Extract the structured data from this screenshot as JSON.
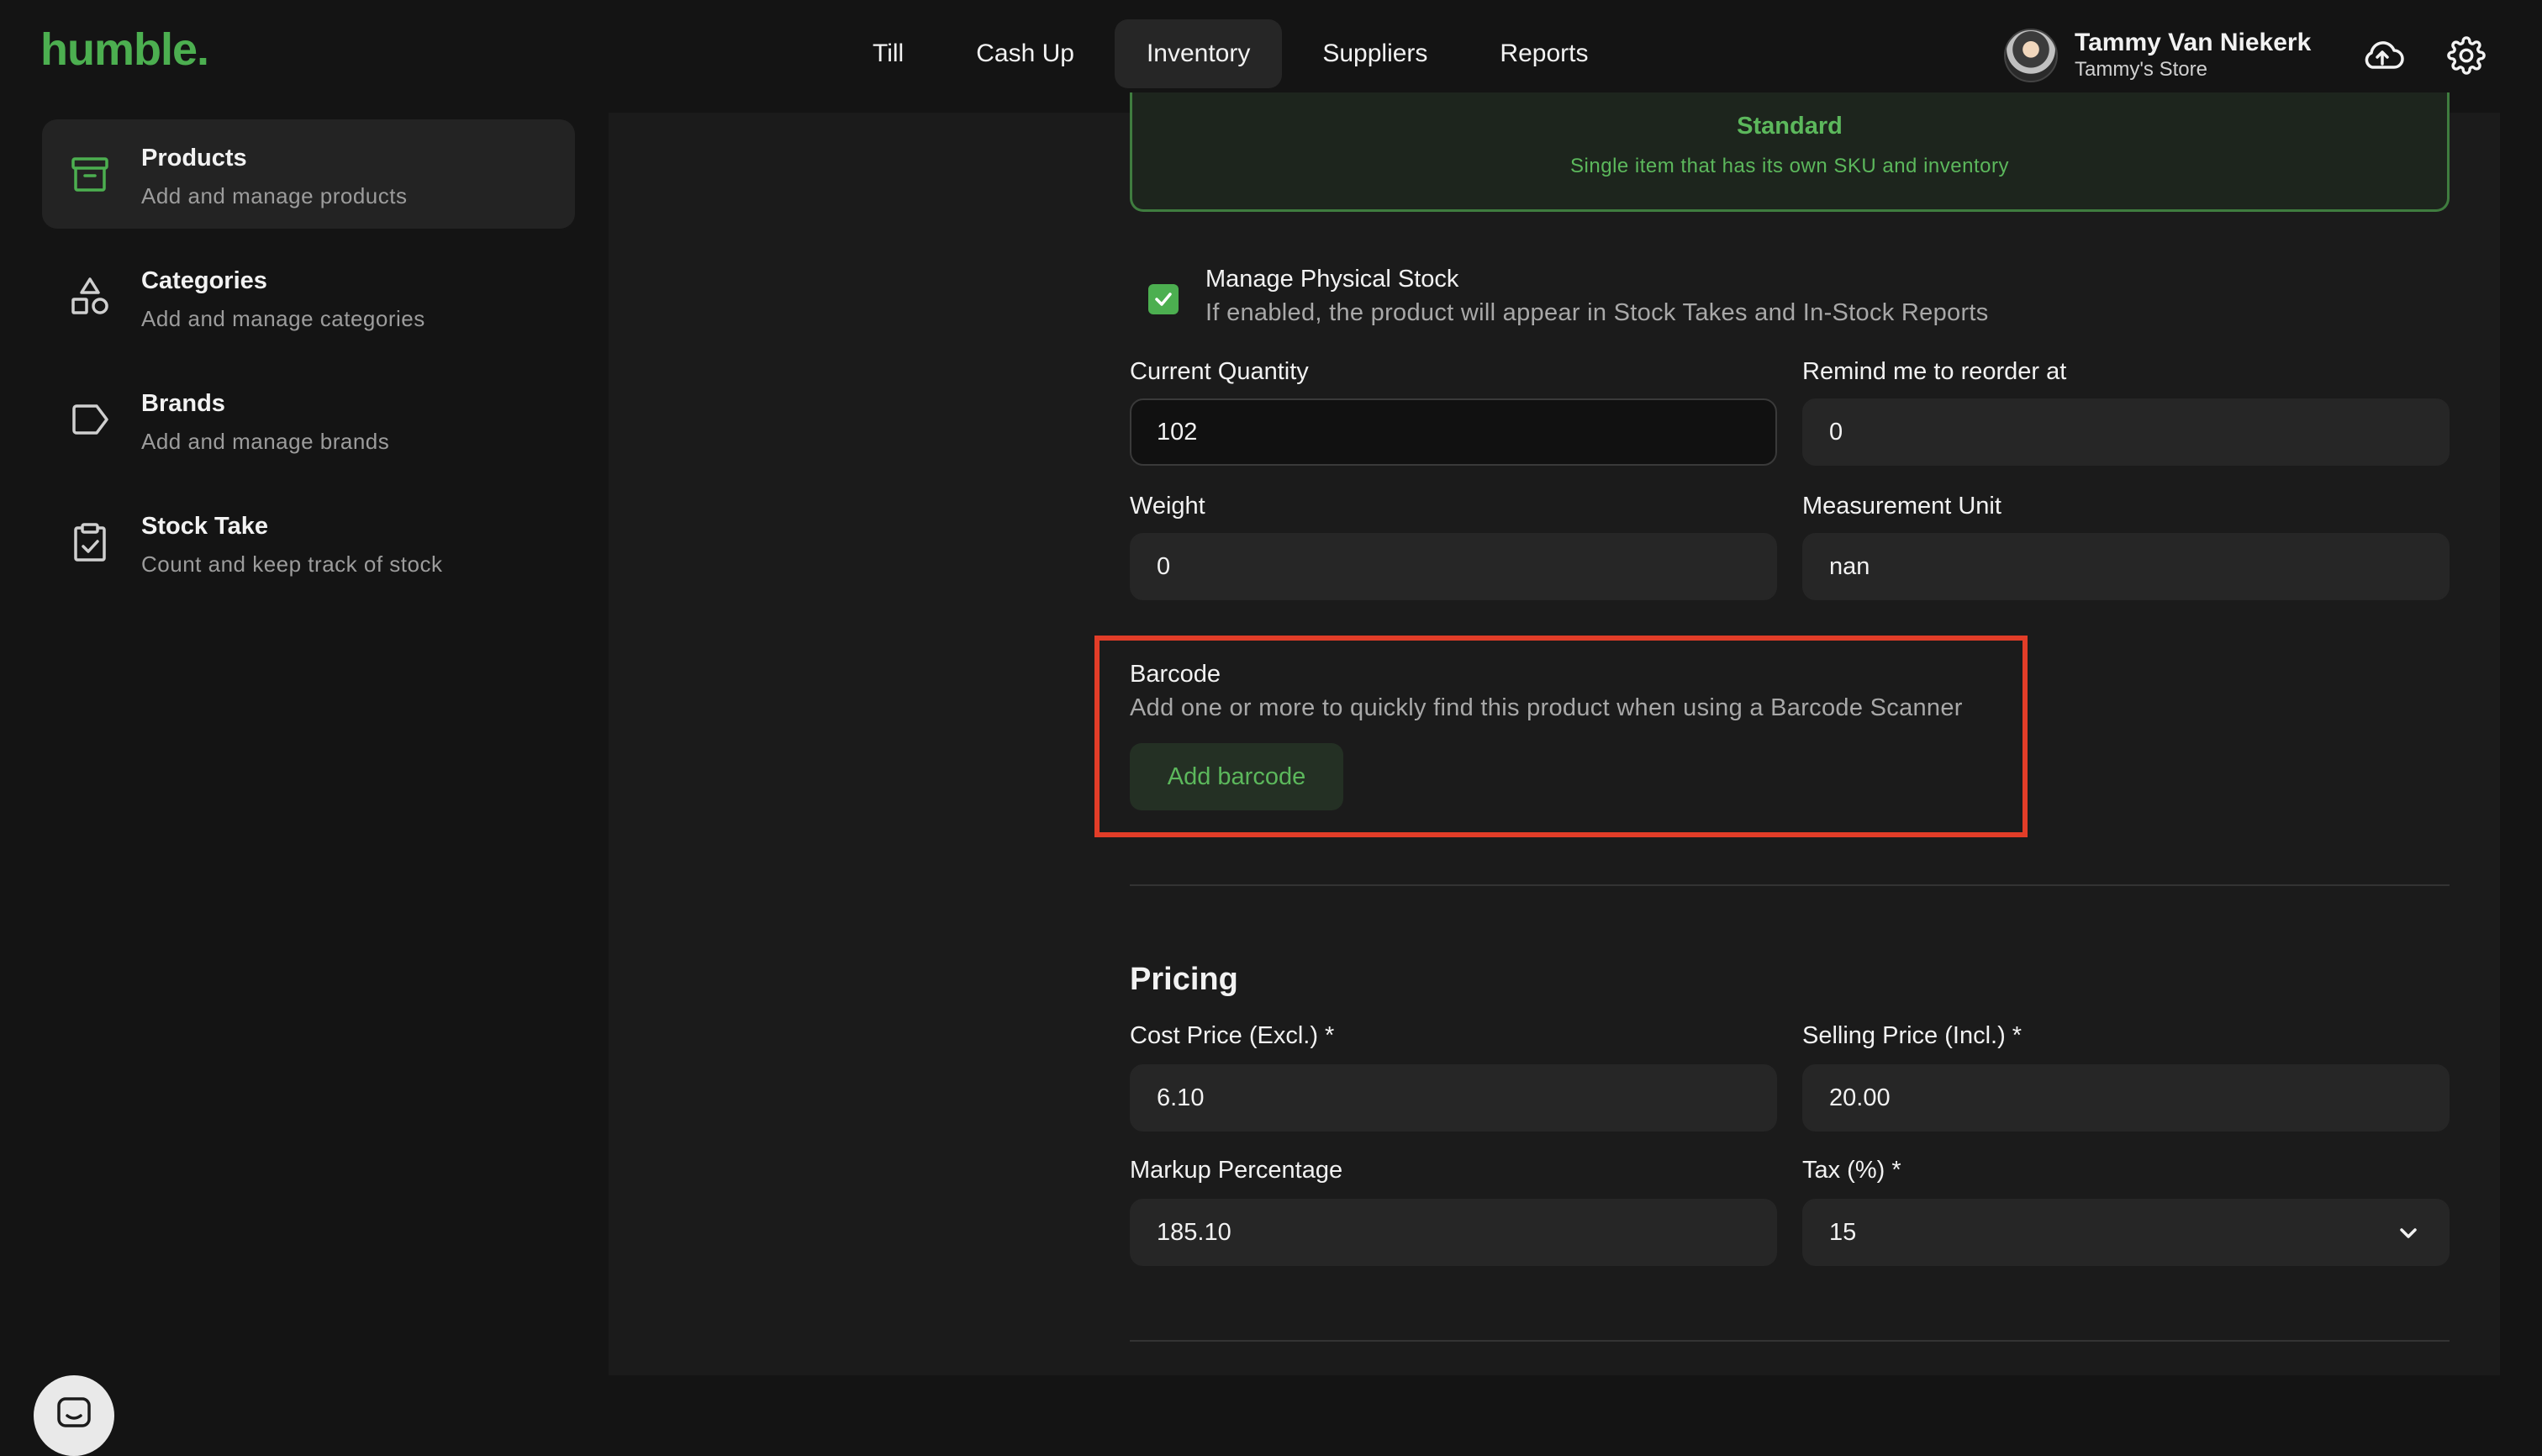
{
  "app": {
    "logo": "humble."
  },
  "nav": {
    "items": [
      {
        "label": "Till"
      },
      {
        "label": "Cash Up"
      },
      {
        "label": "Inventory"
      },
      {
        "label": "Suppliers"
      },
      {
        "label": "Reports"
      }
    ],
    "active": "Inventory"
  },
  "user": {
    "name": "Tammy Van Niekerk",
    "store": "Tammy's Store"
  },
  "icons": {
    "cloud": "cloud-upload-icon",
    "settings": "gear-icon",
    "chat": "chat-icon"
  },
  "sidebar": {
    "items": [
      {
        "title": "Products",
        "subtitle": "Add and manage products",
        "icon": "archive-box-icon"
      },
      {
        "title": "Categories",
        "subtitle": "Add and manage categories",
        "icon": "shapes-icon"
      },
      {
        "title": "Brands",
        "subtitle": "Add and manage brands",
        "icon": "tag-icon"
      },
      {
        "title": "Stock Take",
        "subtitle": "Count and keep track of stock",
        "icon": "clipboard-check-icon"
      }
    ]
  },
  "product_type": {
    "title": "Standard",
    "description": "Single item that has its own SKU and inventory"
  },
  "stock": {
    "manage_label": "Manage Physical Stock",
    "manage_description": "If enabled, the product will appear in Stock Takes and In-Stock Reports",
    "manage_checked": true,
    "current_quantity_label": "Current Quantity",
    "current_quantity": "102",
    "reorder_label": "Remind me to reorder at",
    "reorder_value": "0",
    "weight_label": "Weight",
    "weight_value": "0",
    "unit_label": "Measurement Unit",
    "unit_value": "nan"
  },
  "barcode": {
    "title": "Barcode",
    "description": "Add one or more to quickly find this product when using a Barcode Scanner",
    "add_label": "Add barcode"
  },
  "pricing": {
    "title": "Pricing",
    "cost_label": "Cost Price (Excl.) *",
    "cost_value": "6.10",
    "selling_label": "Selling Price (Incl.) *",
    "selling_value": "20.00",
    "markup_label": "Markup Percentage",
    "markup_value": "185.10",
    "tax_label": "Tax (%) *",
    "tax_value": "15"
  },
  "colors": {
    "accent": "#4caf50",
    "highlight": "#e23d28",
    "background": "#141414",
    "panel": "#1b1b1b"
  }
}
